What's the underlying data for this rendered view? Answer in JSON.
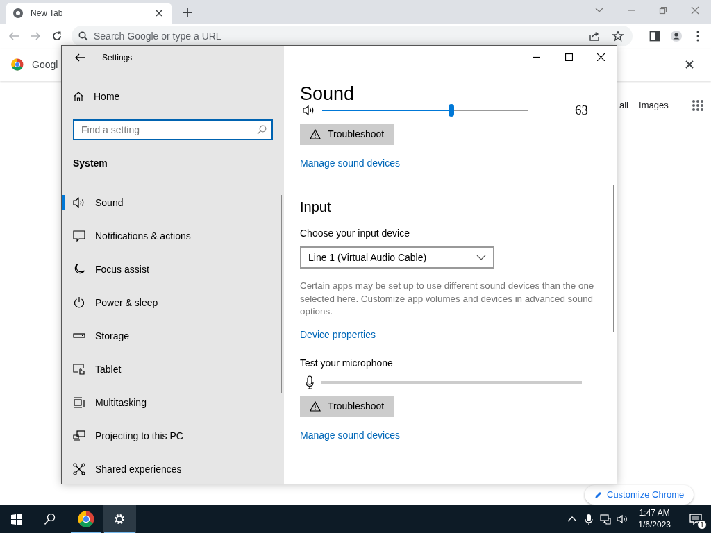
{
  "browser": {
    "tab": {
      "title": "New Tab"
    },
    "omnibox": {
      "placeholder": "Search Google or type a URL"
    },
    "infobar": {
      "text": "Googl"
    },
    "page": {
      "links": [
        "ail",
        "Images"
      ],
      "customize_button": "Customize Chrome"
    }
  },
  "settings": {
    "title": "Settings",
    "home": "Home",
    "search": {
      "placeholder": "Find a setting"
    },
    "section": "System",
    "nav": [
      {
        "label": "Sound",
        "selected": true
      },
      {
        "label": "Notifications & actions",
        "selected": false
      },
      {
        "label": "Focus assist",
        "selected": false
      },
      {
        "label": "Power & sleep",
        "selected": false
      },
      {
        "label": "Storage",
        "selected": false
      },
      {
        "label": "Tablet",
        "selected": false
      },
      {
        "label": "Multitasking",
        "selected": false
      },
      {
        "label": "Projecting to this PC",
        "selected": false
      },
      {
        "label": "Shared experiences",
        "selected": false
      }
    ],
    "content": {
      "title": "Sound",
      "volume": {
        "level": 0.63,
        "reading": "63"
      },
      "output_troubleshoot": "Troubleshoot",
      "output_link": "Manage sound devices",
      "input_heading": "Input",
      "input_device_label": "Choose your input device",
      "input_device": "Line 1 (Virtual Audio Cable)",
      "note": "Certain apps may be set up to use different sound devices than the one selected here. Customize app volumes and devices in advanced sound options.",
      "device_properties": "Device properties",
      "mic_label": "Test your microphone",
      "mic": {
        "level": 0
      },
      "input_troubleshoot": "Troubleshoot",
      "input_link": "Manage sound devices"
    }
  },
  "taskbar": {
    "apps": [
      {
        "active": false
      },
      {
        "active": false
      },
      {
        "active": false
      },
      {
        "active": true
      }
    ],
    "time": "1:47 AM",
    "date": "1/6/2023",
    "notifications": "1"
  }
}
